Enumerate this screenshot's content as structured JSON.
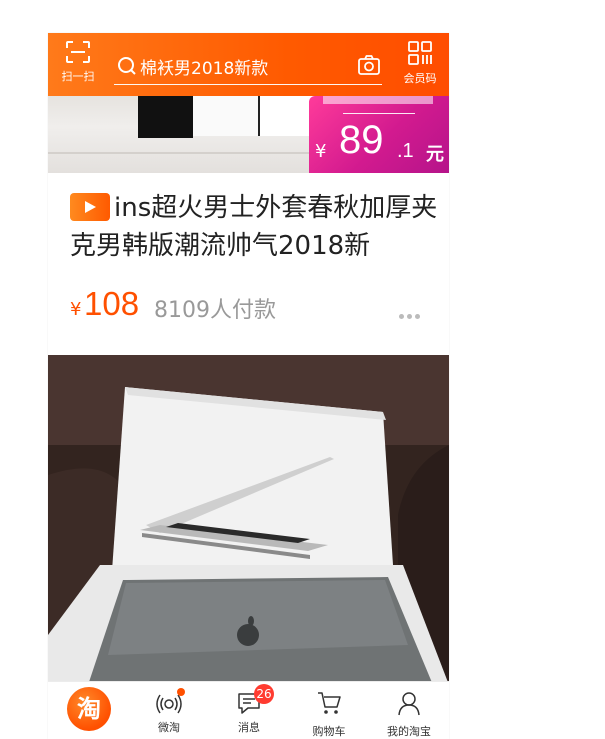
{
  "header": {
    "scan_label": "扫一扫",
    "search_text": "棉袄男2018新款",
    "member_code_label": "会员码"
  },
  "product1": {
    "tag_currency": "¥",
    "tag_amount": "89",
    "tag_decimal": ".1",
    "tag_unit": "元",
    "title": "ins超火男士外套春秋加厚夹克男韩版潮流帅气2018新",
    "price_symbol": "¥",
    "price": "108",
    "sold_text": "8109人付款"
  },
  "tabs": [
    {
      "label": "淘",
      "icon": "taobao-logo"
    },
    {
      "label": "微淘",
      "icon": "weitao-icon"
    },
    {
      "label": "消息",
      "icon": "message-icon",
      "badge": "26"
    },
    {
      "label": "购物车",
      "icon": "cart-icon"
    },
    {
      "label": "我的淘宝",
      "icon": "profile-icon"
    }
  ],
  "colors": {
    "brand_orange": "#ff5000",
    "price_tag_pink": "#d21a8f"
  }
}
